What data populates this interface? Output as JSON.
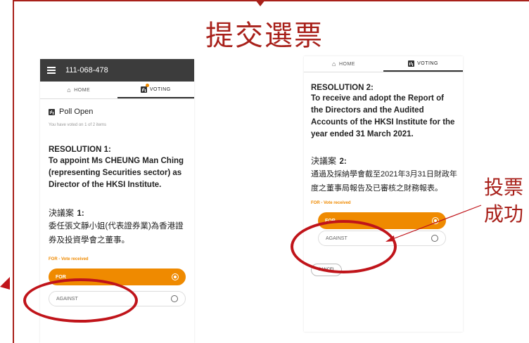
{
  "slide": {
    "title": "提交選票",
    "side_note_line1": "投票",
    "side_note_line2": "成功"
  },
  "screen1": {
    "meeting_id": "111-068-478",
    "tab_home": "HOME",
    "tab_voting": "VOTING",
    "poll_status": "Poll Open",
    "voted_note": "You have voted on 1 of 2 items",
    "resolution_title": "RESOLUTION 1:",
    "resolution_text": "To appoint Ms CHEUNG Man Ching (representing Securities sector) as Director of the HKSI Institute.",
    "resolution_zh_label": "決議案",
    "resolution_zh_number": "1:",
    "resolution_zh_text": "委任張文靜小姐(代表證券業)為香港證券及投資學會之董事。",
    "vote_status": "FOR - Vote received",
    "for_label": "FOR",
    "against_label": "AGAINST"
  },
  "screen2": {
    "tab_home": "HOME",
    "tab_voting": "VOTING",
    "resolution_title": "RESOLUTION 2:",
    "resolution_text": "To receive and adopt the Report of the Directors and the Audited Accounts of the HKSI Institute for the year ended 31 March 2021.",
    "resolution_zh_label": "決議案",
    "resolution_zh_number": "2:",
    "resolution_zh_text": "通過及採納學會截至2021年3月31日財政年度之董事局報告及已審核之財務報表。",
    "vote_status": "FOR - Vote received",
    "for_label": "FOR",
    "against_label": "AGAINST",
    "cancel_label": "CANCEL"
  },
  "colors": {
    "accent": "#ef8a00",
    "annotation_red": "#c0141a",
    "appbar": "#3c3c3c"
  },
  "icons": [
    "menu-icon",
    "home-icon",
    "voting-icon",
    "poll-icon",
    "radio-selected-icon",
    "radio-empty-icon"
  ]
}
